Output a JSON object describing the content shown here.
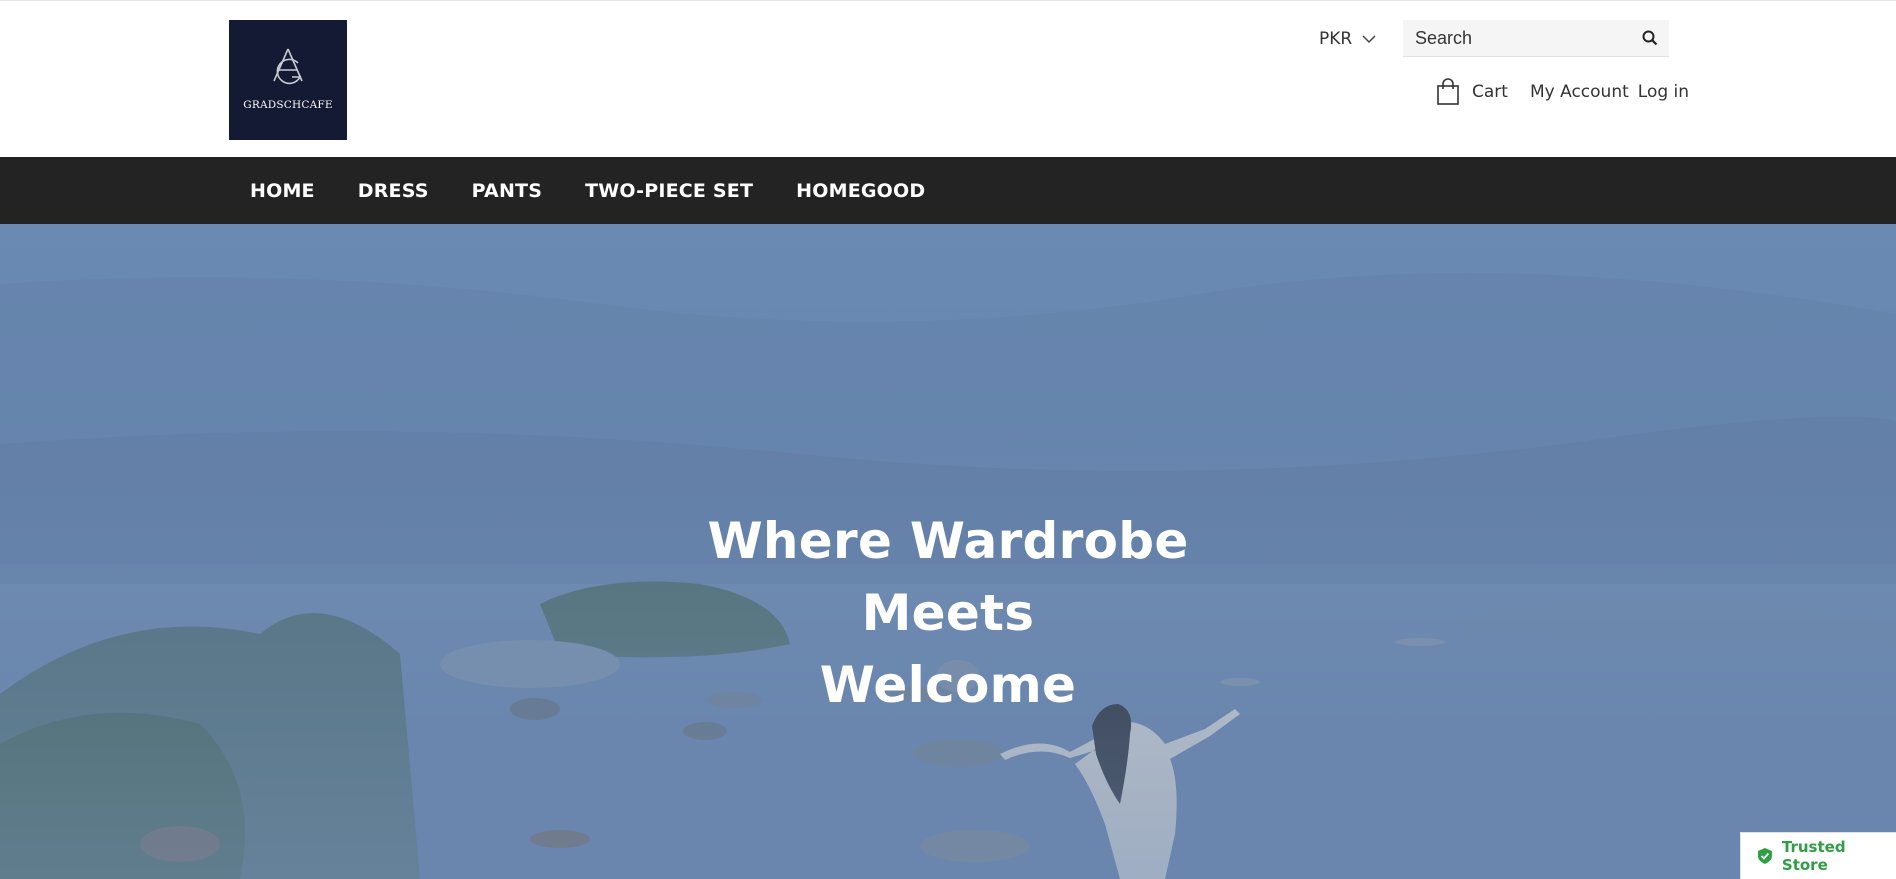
{
  "header": {
    "logo_text": "GRADSCHCAFE",
    "currency": {
      "selected": "PKR",
      "icon": "chevron-down-icon"
    },
    "search": {
      "placeholder": "Search",
      "icon": "search-icon"
    },
    "cart_label": "Cart",
    "account_label": "My Account",
    "login_label": "Log in"
  },
  "nav": {
    "items": [
      {
        "label": "HOME"
      },
      {
        "label": "DRESS"
      },
      {
        "label": "PANTS"
      },
      {
        "label": "TWO-PIECE SET"
      },
      {
        "label": "HOMEGOOD"
      }
    ]
  },
  "hero": {
    "title_line1": "Where Wardrobe Meets",
    "title_line2": "Welcome"
  },
  "badge": {
    "label": "Trusted Store",
    "color": "#2f9e44",
    "icon": "shield-check-icon"
  },
  "colors": {
    "nav_bg": "#232323",
    "logo_bg": "#141a33",
    "hero_sky": "#6a8ab3"
  }
}
